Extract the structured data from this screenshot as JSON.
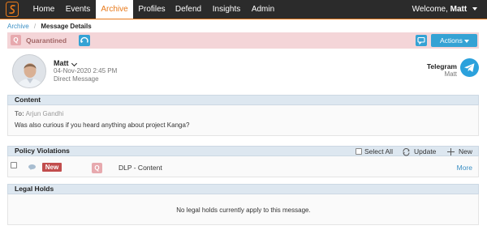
{
  "nav": {
    "items": [
      {
        "label": "Home",
        "active": false
      },
      {
        "label": "Events",
        "active": false
      },
      {
        "label": "Archive",
        "active": true
      },
      {
        "label": "Profiles",
        "active": false
      },
      {
        "label": "Defend",
        "active": false
      },
      {
        "label": "Insights",
        "active": false
      },
      {
        "label": "Admin",
        "active": false
      }
    ],
    "welcome_prefix": "Welcome,",
    "user": "Matt",
    "accent_color": "#e8791a"
  },
  "breadcrumb": {
    "parent": "Archive",
    "separator": "/",
    "current": "Message Details"
  },
  "quarantine_bar": {
    "icon_letter": "Q",
    "label": "Quarantined",
    "actions_label": "Actions",
    "background": "#f4d5d8"
  },
  "sender": {
    "name": "Matt",
    "date": "04-Nov-2020 2:45 PM",
    "type": "Direct Message",
    "channel": "Telegram",
    "channel_user": "Matt"
  },
  "content": {
    "title": "Content",
    "to_label": "To:",
    "to_value": "Arjun Gandhi",
    "message": "Was also curious if you heard anything about project Kanga?"
  },
  "policy_violations": {
    "title": "Policy Violations",
    "select_all": "Select All",
    "update": "Update",
    "new": "New",
    "rows": [
      {
        "badge": "New",
        "icon_letter": "Q",
        "policy": "DLP - Content",
        "more": "More"
      }
    ]
  },
  "legal_holds": {
    "title": "Legal Holds",
    "empty_text": "No legal holds currently apply to this message."
  }
}
